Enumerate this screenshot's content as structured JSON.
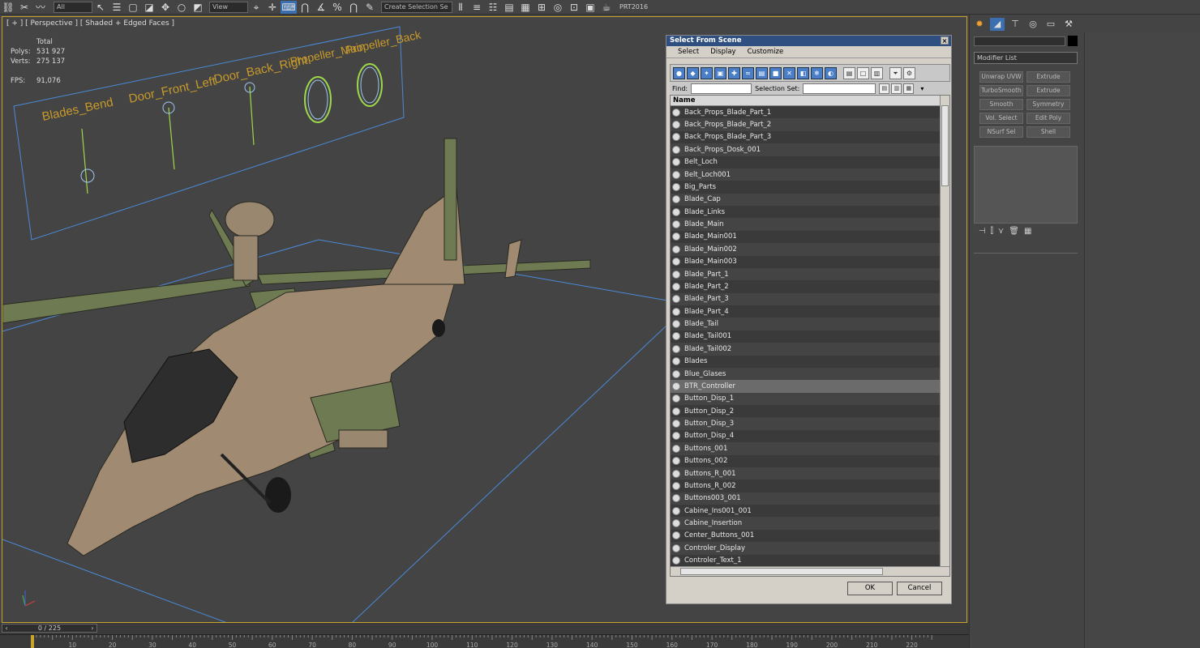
{
  "toolbar": {
    "selection_set_combo": "Create Selection Se",
    "view_combo": "View",
    "all_combo": "All",
    "prt_label": "PRT2016"
  },
  "viewport": {
    "label": "[ + ] [ Perspective ] [ Shaded + Edged Faces ]",
    "stats": {
      "total_label": "Total",
      "polys_label": "Polys:",
      "polys_value": "531 927",
      "verts_label": "Verts:",
      "verts_value": "275 137",
      "fps_label": "FPS:",
      "fps_value": "91,076"
    },
    "controllers": [
      "Blades_Bend",
      "Door_Front_Left",
      "Door_Back_Right",
      "Propeller_Main",
      "Propeller_Back"
    ]
  },
  "dialog": {
    "title": "Select From Scene",
    "close": "×",
    "menu": [
      "Select",
      "Display",
      "Customize"
    ],
    "find_label": "Find:",
    "selection_set_label": "Selection Set:",
    "column_name": "Name",
    "items": [
      "Back_Props_Blade_Part_1",
      "Back_Props_Blade_Part_2",
      "Back_Props_Blade_Part_3",
      "Back_Props_Dosk_001",
      "Belt_Loch",
      "Belt_Loch001",
      "Big_Parts",
      "Blade_Cap",
      "Blade_Links",
      "Blade_Main",
      "Blade_Main001",
      "Blade_Main002",
      "Blade_Main003",
      "Blade_Part_1",
      "Blade_Part_2",
      "Blade_Part_3",
      "Blade_Part_4",
      "Blade_Tail",
      "Blade_Tail001",
      "Blade_Tail002",
      "Blades",
      "Blue_Glases",
      "BTR_Controller",
      "Button_Disp_1",
      "Button_Disp_2",
      "Button_Disp_3",
      "Button_Disp_4",
      "Buttons_001",
      "Buttons_002",
      "Buttons_R_001",
      "Buttons_R_002",
      "Buttons003_001",
      "Cabine_Ins001_001",
      "Cabine_Insertion",
      "Center_Buttons_001",
      "Controler_Display",
      "Controler_Text_1"
    ],
    "selected_item": "BTR_Controller",
    "ok_label": "OK",
    "cancel_label": "Cancel"
  },
  "command_panel": {
    "modifier_list": "Modifier List",
    "buttons": [
      "Unwrap UVW",
      "Extrude",
      "TurboSmooth",
      "Extrude",
      "Smooth",
      "Symmetry",
      "Vol. Select",
      "Edit Poly",
      "NSurf Sel",
      "Shell"
    ]
  },
  "timeline": {
    "frame": "0 / 225",
    "ticks": [
      "10",
      "20",
      "30",
      "40",
      "50",
      "60",
      "70",
      "80",
      "90",
      "100",
      "110",
      "120",
      "130",
      "140",
      "150",
      "160",
      "170",
      "180",
      "190",
      "200",
      "210",
      "220"
    ]
  },
  "colors": {
    "viewport_border": "#c8a52a",
    "controller_text": "#c89a2a",
    "controller_green": "#9ed84a",
    "plane_blue": "#4a8ad8",
    "dialog_title": "#2f4f80"
  }
}
